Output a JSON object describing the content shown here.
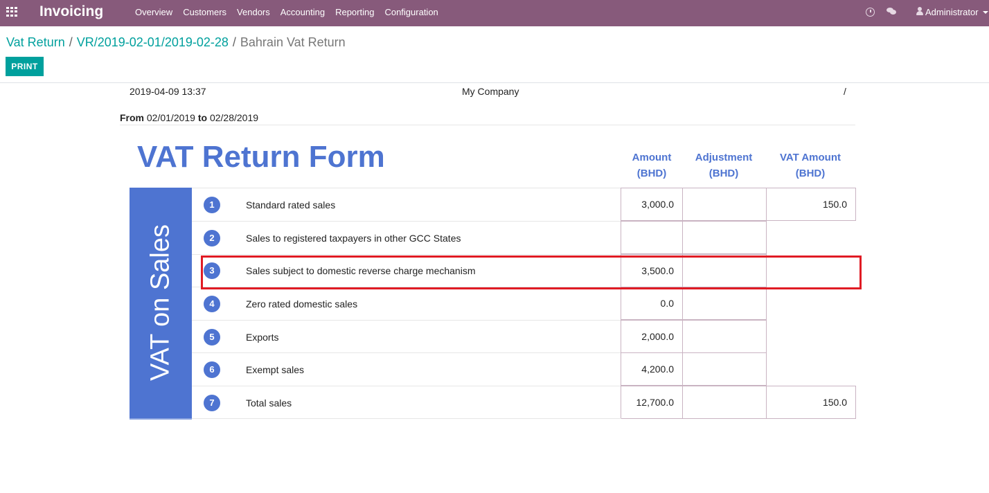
{
  "navbar": {
    "app_title": "Invoicing",
    "menu": [
      "Overview",
      "Customers",
      "Vendors",
      "Accounting",
      "Reporting",
      "Configuration"
    ],
    "user": "Administrator"
  },
  "breadcrumb": {
    "items": [
      "Vat Return",
      "VR/2019-02-01/2019-02-28"
    ],
    "current": "Bahrain Vat Return"
  },
  "toolbar": {
    "print_label": "PRINT"
  },
  "report": {
    "date": "2019-04-09 13:37",
    "company": "My Company",
    "page_marker": "/",
    "from_label": "From",
    "from_date": "02/01/2019",
    "to_label": "to",
    "to_date": "02/28/2019",
    "title": "VAT Return Form",
    "side_label": "VAT on Sales",
    "columns": [
      {
        "line1": "Amount",
        "line2": "(BHD)"
      },
      {
        "line1": "Adjustment",
        "line2": "(BHD)"
      },
      {
        "line1": "VAT Amount",
        "line2": "(BHD)"
      }
    ],
    "rows": [
      {
        "num": "1",
        "label": "Standard rated sales",
        "amount": "3,000.0",
        "adjustment": "",
        "vat": "150.0"
      },
      {
        "num": "2",
        "label": "Sales to registered taxpayers in other GCC States",
        "amount": "",
        "adjustment": "",
        "vat": ""
      },
      {
        "num": "3",
        "label": "Sales subject to domestic reverse charge mechanism",
        "amount": "3,500.0",
        "adjustment": "",
        "vat": ""
      },
      {
        "num": "4",
        "label": "Zero rated domestic sales",
        "amount": "0.0",
        "adjustment": "",
        "vat": ""
      },
      {
        "num": "5",
        "label": "Exports",
        "amount": "2,000.0",
        "adjustment": "",
        "vat": ""
      },
      {
        "num": "6",
        "label": "Exempt sales",
        "amount": "4,200.0",
        "adjustment": "",
        "vat": ""
      },
      {
        "num": "7",
        "label": "Total sales",
        "amount": "12,700.0",
        "adjustment": "",
        "vat": "150.0"
      }
    ]
  },
  "colors": {
    "navbar": "#875a7b",
    "accent": "#00a09d",
    "report_blue": "#4e74d1",
    "highlight": "#e01b24"
  }
}
